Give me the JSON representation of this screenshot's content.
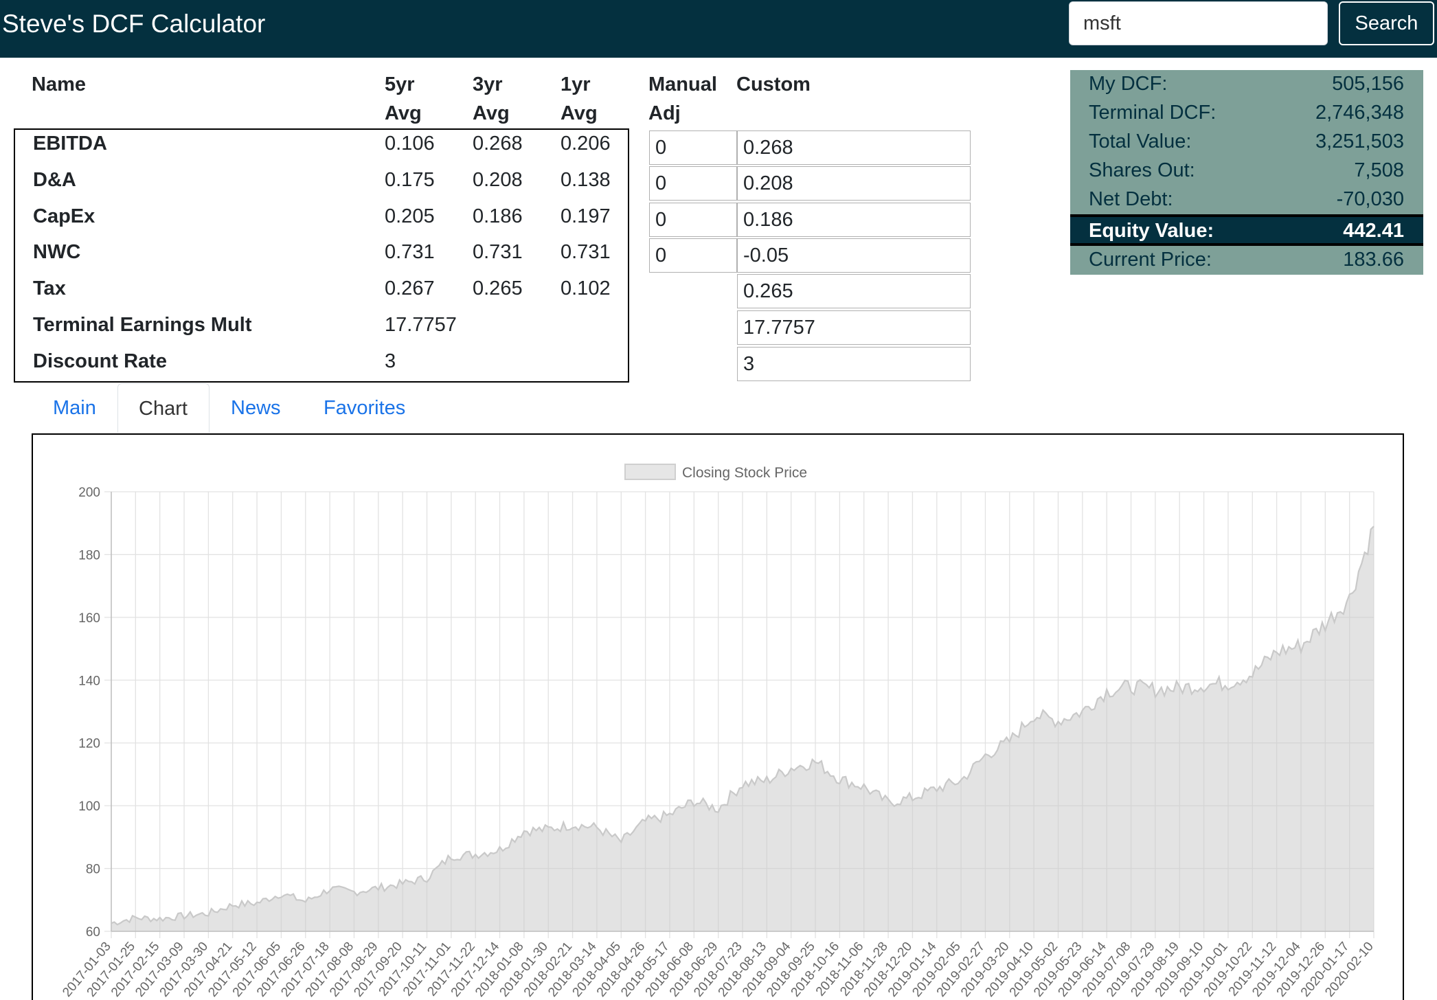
{
  "navbar": {
    "brand": "Steve's DCF Calculator",
    "search_value": "msft",
    "search_button": "Search"
  },
  "table": {
    "headers": {
      "name": "Name",
      "yr5_a": "5yr",
      "yr5_b": "Avg",
      "yr3_a": "3yr",
      "yr3_b": "Avg",
      "yr1_a": "1yr",
      "yr1_b": "Avg",
      "manual_a": "Manual",
      "manual_b": "Adj",
      "custom": "Custom"
    },
    "rows": [
      {
        "name": "EBITDA",
        "y5": "0.106",
        "y3": "0.268",
        "y1": "0.206",
        "adj": "0",
        "custom": "0.268"
      },
      {
        "name": "D&A",
        "y5": "0.175",
        "y3": "0.208",
        "y1": "0.138",
        "adj": "0",
        "custom": "0.208"
      },
      {
        "name": "CapEx",
        "y5": "0.205",
        "y3": "0.186",
        "y1": "0.197",
        "adj": "0",
        "custom": "0.186"
      },
      {
        "name": "NWC",
        "y5": "0.731",
        "y3": "0.731",
        "y1": "0.731",
        "adj": "0",
        "custom": "-0.05"
      },
      {
        "name": "Tax",
        "y5": "0.267",
        "y3": "0.265",
        "y1": "0.102",
        "custom": "0.265"
      },
      {
        "name": "Terminal Earnings Mult",
        "y5": "17.7757",
        "custom": "17.7757"
      },
      {
        "name": "Discount Rate",
        "y5": "3",
        "custom": "3"
      }
    ]
  },
  "summary": {
    "my_dcf_label": "My DCF:",
    "my_dcf": "505,156",
    "terminal_dcf_label": "Terminal DCF:",
    "terminal_dcf": "2,746,348",
    "total_value_label": "Total Value:",
    "total_value": "3,251,503",
    "shares_out_label": "Shares Out:",
    "shares_out": "7,508",
    "net_debt_label": "Net Debt:",
    "net_debt": "-70,030",
    "equity_value_label": "Equity Value:",
    "equity_value": "442.41",
    "current_price_label": "Current Price:",
    "current_price": "183.66"
  },
  "tabs": {
    "main": "Main",
    "chart": "Chart",
    "news": "News",
    "favorites": "Favorites",
    "active": "chart"
  },
  "colors": {
    "navbar": "#04303f",
    "summary_bg": "#7ea098",
    "link": "#1a73e8"
  },
  "chart_data": {
    "type": "area",
    "legend": "Closing Stock Price",
    "legend_position": "top-center",
    "grid": true,
    "ylim": [
      60,
      200
    ],
    "y_ticks": [
      200,
      180,
      160,
      140,
      120,
      100,
      80,
      60
    ],
    "x_tick_labels": [
      "2017-01-03",
      "2017-01-25",
      "2017-02-15",
      "2017-03-09",
      "2017-03-30",
      "2017-04-21",
      "2017-05-12",
      "2017-06-05",
      "2017-06-26",
      "2017-07-18",
      "2017-08-08",
      "2017-08-29",
      "2017-09-20",
      "2017-10-11",
      "2017-11-01",
      "2017-11-22",
      "2017-12-14",
      "2018-01-08",
      "2018-01-30",
      "2018-02-21",
      "2018-03-14",
      "2018-04-05",
      "2018-04-26",
      "2018-05-17",
      "2018-06-08",
      "2018-06-29",
      "2018-07-23",
      "2018-08-13",
      "2018-09-04",
      "2018-09-25",
      "2018-10-16",
      "2018-11-06",
      "2018-11-28",
      "2018-12-20",
      "2019-01-14",
      "2019-02-05",
      "2019-02-27",
      "2019-03-20",
      "2019-04-10",
      "2019-05-02",
      "2019-05-23",
      "2019-06-14",
      "2019-07-08",
      "2019-07-29",
      "2019-08-19",
      "2019-09-10",
      "2019-10-01",
      "2019-10-22",
      "2019-11-12",
      "2019-12-04",
      "2019-12-26",
      "2020-01-17",
      "2020-02-10"
    ],
    "y_at_ticks": [
      62.6,
      64.3,
      64.0,
      64.9,
      65.7,
      68.4,
      69.0,
      72.0,
      69.5,
      73.5,
      72.5,
      73.8,
      75.2,
      77.0,
      84.0,
      84.5,
      86.0,
      92.0,
      92.5,
      94.0,
      93.0,
      88.5,
      95.0,
      97.0,
      101.5,
      99.0,
      107.0,
      108.0,
      112.0,
      114.0,
      108.5,
      106.0,
      101.0,
      102.5,
      105.5,
      108.0,
      116.0,
      120.5,
      129.0,
      127.0,
      130.0,
      136.5,
      138.0,
      137.0,
      137.5,
      138.5,
      139.0,
      142.0,
      149.0,
      151.0,
      158.0,
      166.0,
      189.0
    ]
  }
}
